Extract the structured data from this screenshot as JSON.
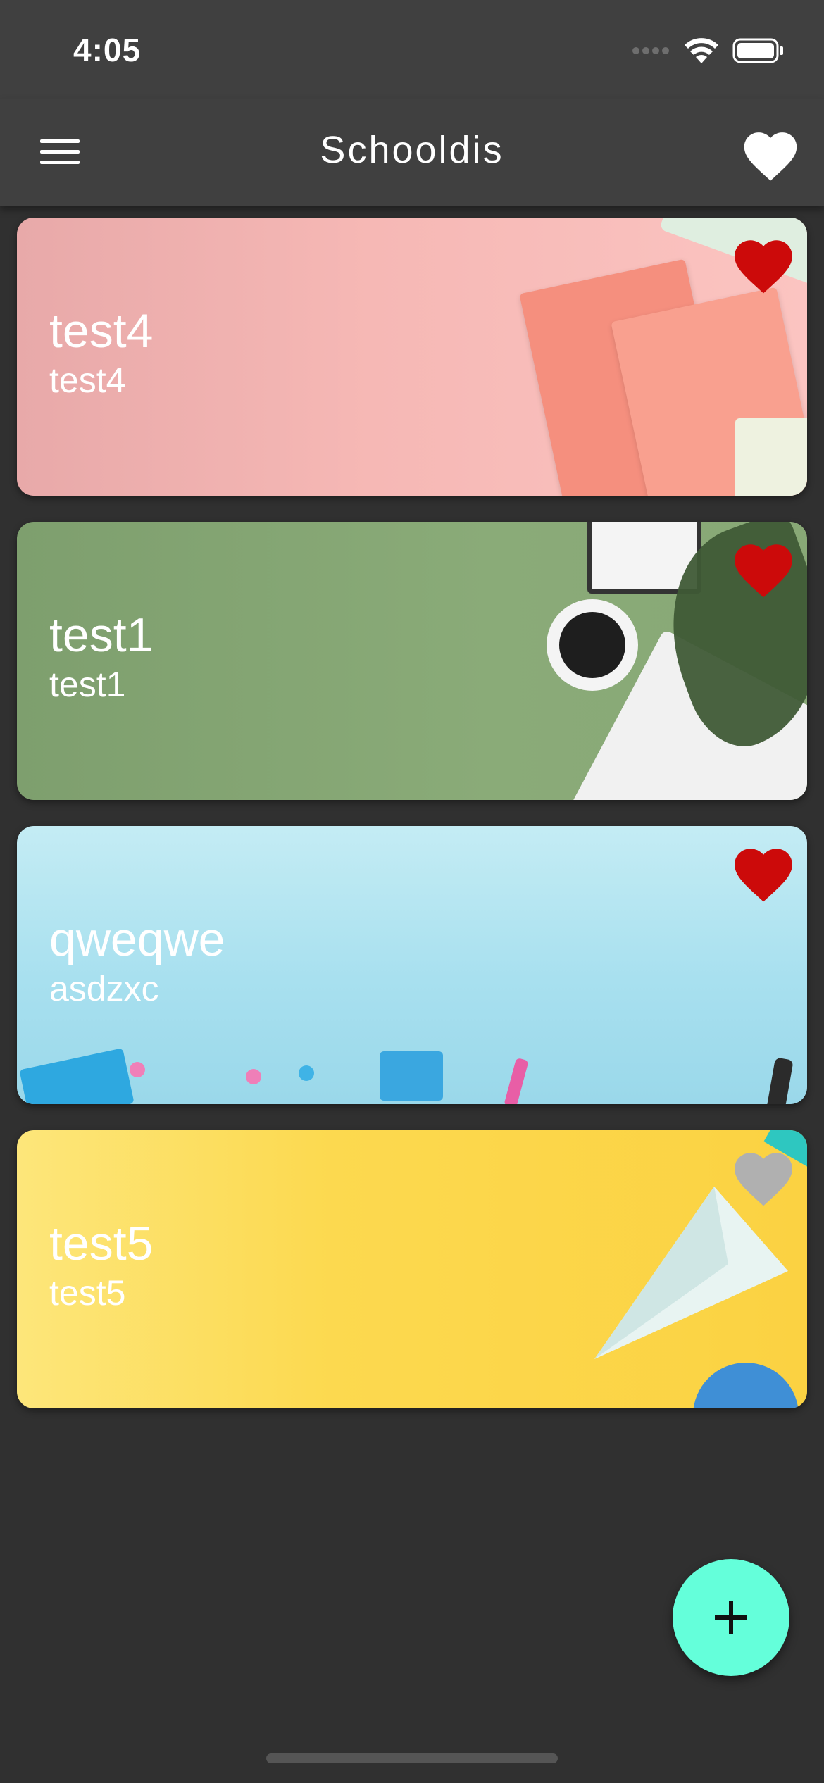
{
  "status_bar": {
    "time": "4:05",
    "icons": [
      "signal-dots-icon",
      "wifi-icon",
      "battery-icon"
    ]
  },
  "app_bar": {
    "title": "Schooldis",
    "menu_icon": "hamburger-menu-icon",
    "favorites_icon": "heart-icon"
  },
  "colors": {
    "background": "#303030",
    "app_bar": "#404040",
    "favorite_active": "#cc0a0a",
    "favorite_inactive": "#b0b0b0",
    "fab": "#64ffda"
  },
  "cards": [
    {
      "title": "test4",
      "subtitle": "test4",
      "theme": "pink",
      "favorite": true
    },
    {
      "title": "test1",
      "subtitle": "test1",
      "theme": "green",
      "favorite": true
    },
    {
      "title": "qweqwe",
      "subtitle": "asdzxc",
      "theme": "blue",
      "favorite": true
    },
    {
      "title": "test5",
      "subtitle": "test5",
      "theme": "yellow",
      "favorite": false
    }
  ],
  "fab": {
    "icon": "plus-icon",
    "label": "+"
  }
}
